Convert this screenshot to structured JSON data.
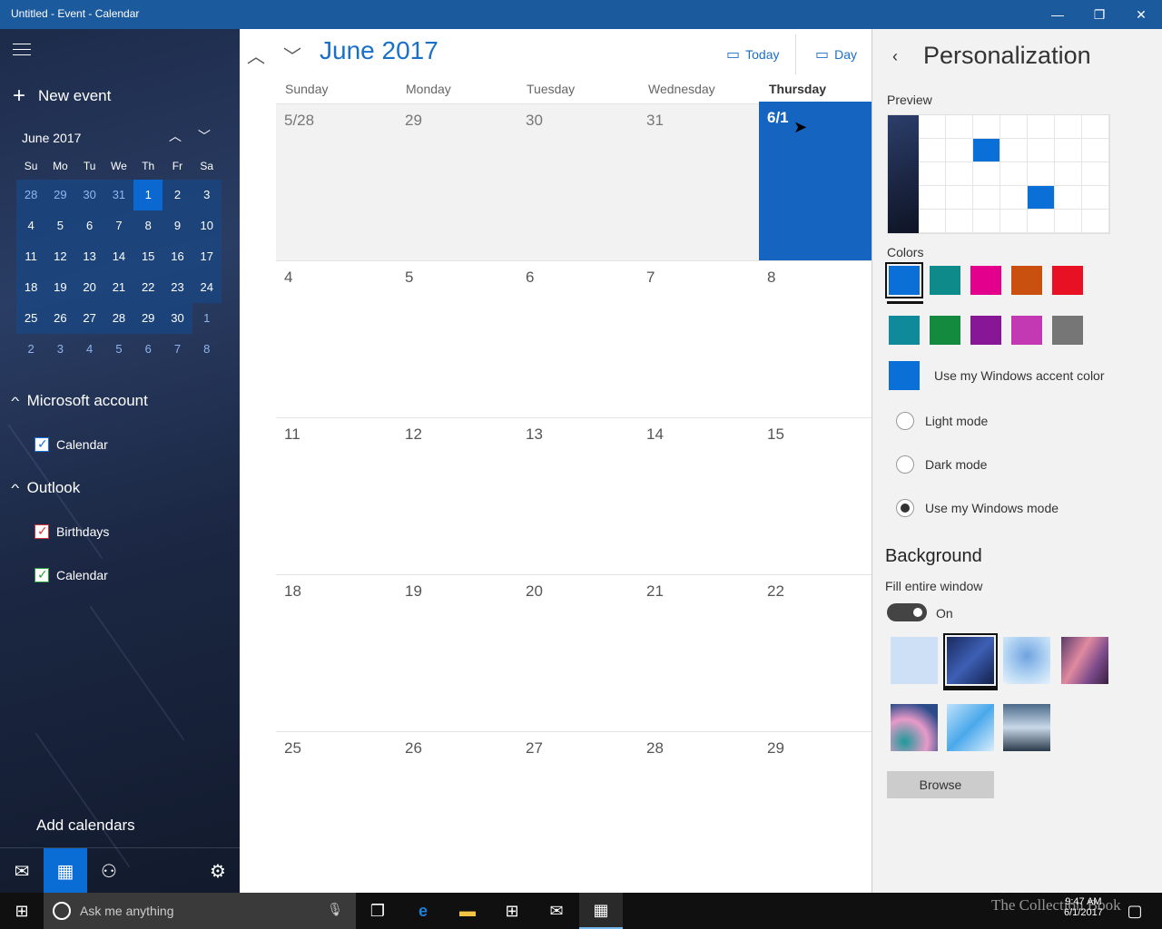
{
  "window": {
    "title": "Untitled - Event - Calendar",
    "min": "—",
    "max": "❐",
    "close": "✕"
  },
  "sidebar": {
    "new_event": "New event",
    "mini_calendar": {
      "month": "June 2017",
      "weekdays": [
        "Su",
        "Mo",
        "Tu",
        "We",
        "Th",
        "Fr",
        "Sa"
      ],
      "weeks": [
        [
          "28",
          "29",
          "30",
          "31",
          "1",
          "2",
          "3"
        ],
        [
          "4",
          "5",
          "6",
          "7",
          "8",
          "9",
          "10"
        ],
        [
          "11",
          "12",
          "13",
          "14",
          "15",
          "16",
          "17"
        ],
        [
          "18",
          "19",
          "20",
          "21",
          "22",
          "23",
          "24"
        ],
        [
          "25",
          "26",
          "27",
          "28",
          "29",
          "30",
          "1"
        ],
        [
          "2",
          "3",
          "4",
          "5",
          "6",
          "7",
          "8"
        ]
      ],
      "today": "1"
    },
    "accounts": [
      {
        "name": "Microsoft account",
        "calendars": [
          {
            "label": "Calendar",
            "color": "#1a6fd6"
          }
        ]
      },
      {
        "name": "Outlook",
        "calendars": [
          {
            "label": "Birthdays",
            "color": "#d13438"
          },
          {
            "label": "Calendar",
            "color": "#2a9d3a"
          }
        ]
      }
    ],
    "add_calendars": "Add calendars",
    "bottom_icons": [
      "mail-icon",
      "calendar-icon",
      "people-icon",
      "gear-icon"
    ]
  },
  "main": {
    "month_title": "June 2017",
    "today_label": "Today",
    "day_label": "Day",
    "weekday_headers": [
      "Sunday",
      "Monday",
      "Tuesday",
      "Wednesday",
      "Thursday"
    ],
    "weeks": [
      [
        "5/28",
        "29",
        "30",
        "31",
        "6/1"
      ],
      [
        "4",
        "5",
        "6",
        "7",
        "8"
      ],
      [
        "11",
        "12",
        "13",
        "14",
        "15"
      ],
      [
        "18",
        "19",
        "20",
        "21",
        "22"
      ],
      [
        "25",
        "26",
        "27",
        "28",
        "29"
      ]
    ],
    "selected_day": "6/1"
  },
  "personalization": {
    "title": "Personalization",
    "preview_label": "Preview",
    "colors_label": "Colors",
    "colors": [
      "#0a6fd6",
      "#0f8a8a",
      "#e3008c",
      "#ca5010",
      "#e81123",
      "#0e8a9a",
      "#138a3e",
      "#881798",
      "#c239b3",
      "#767676"
    ],
    "selected_color": "#0a6fd6",
    "accent_option": "Use my Windows accent color",
    "accent_color": "#0a6fd6",
    "modes": [
      "Light mode",
      "Dark mode",
      "Use my Windows mode"
    ],
    "selected_mode": "Use my Windows mode",
    "background_title": "Background",
    "fill_label": "Fill entire window",
    "fill_state": "On",
    "fill_on": true,
    "browse": "Browse"
  },
  "taskbar": {
    "search_placeholder": "Ask me anything",
    "time": "9:47 AM",
    "date": "6/1/2017",
    "watermark": "The Collection Book"
  }
}
